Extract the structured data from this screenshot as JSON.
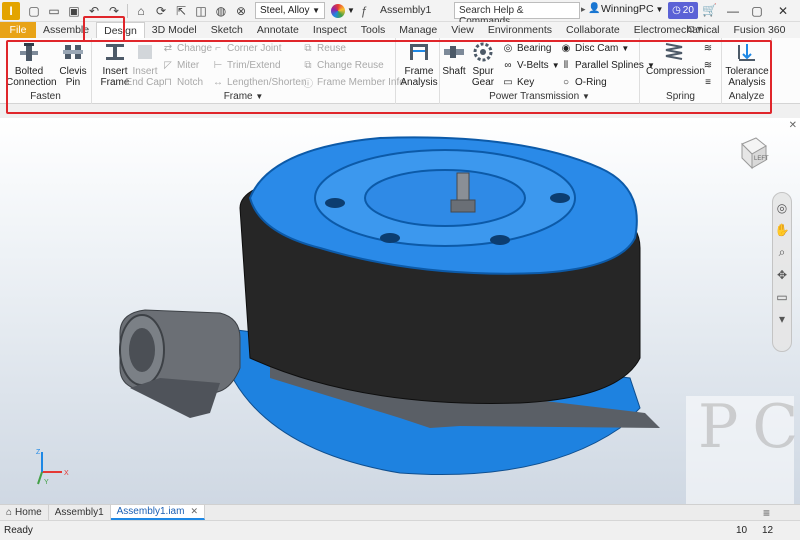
{
  "app": {
    "logo_letter": "I",
    "document_title": "Assembly1",
    "material": "Steel, Alloy",
    "search_placeholder": "Search Help & Commands...",
    "user_name": "WinningPC",
    "clock_badge": "20"
  },
  "tabs": [
    {
      "label": "File"
    },
    {
      "label": "Assemble"
    },
    {
      "label": "Design",
      "active": true
    },
    {
      "label": "3D Model"
    },
    {
      "label": "Sketch"
    },
    {
      "label": "Annotate"
    },
    {
      "label": "Inspect"
    },
    {
      "label": "Tools"
    },
    {
      "label": "Manage"
    },
    {
      "label": "View"
    },
    {
      "label": "Environments"
    },
    {
      "label": "Collaborate"
    },
    {
      "label": "Electromechanical"
    },
    {
      "label": "Fusion 360"
    }
  ],
  "ribbon": {
    "fasten": {
      "label": "Fasten",
      "bolted_connection": "Bolted\nConnection",
      "clevis_pin": "Clevis\nPin"
    },
    "frame": {
      "label": "Frame",
      "insert_frame": "Insert\nFrame",
      "insert_end_cap": "Insert\nEnd Cap",
      "change": "Change",
      "miter": "Miter",
      "notch": "Notch",
      "corner_joint": "Corner Joint",
      "trim_extend": "Trim/Extend",
      "lengthen_shorten": "Lengthen/Shorten",
      "reuse": "Reuse",
      "change_reuse": "Change Reuse",
      "frame_member_info": "Frame Member Info"
    },
    "frame_analysis": {
      "label": "Frame\nAnalysis"
    },
    "power_transmission": {
      "label": "Power Transmission",
      "shaft": "Shaft",
      "spur_gear": "Spur\nGear",
      "bearing": "Bearing",
      "v_belts": "V-Belts",
      "key": "Key",
      "disc_cam": "Disc Cam",
      "parallel_splines": "Parallel Splines",
      "o_ring": "O-Ring"
    },
    "spring": {
      "label": "Spring",
      "compression": "Compression"
    },
    "analyze": {
      "label": "Analyze",
      "tolerance_analysis": "Tolerance\nAnalysis"
    }
  },
  "viewcube_face": "LEFT",
  "triad": {
    "x": "X",
    "y": "Y",
    "z": "Z"
  },
  "watermark": "PC",
  "doc_tabs": [
    {
      "label": "Home"
    },
    {
      "label": "Assembly1"
    },
    {
      "label": "Assembly1.iam",
      "active": true
    }
  ],
  "status": {
    "left": "Ready",
    "num1": "10",
    "num2": "12"
  },
  "colors": {
    "file_tab": "#e8a317",
    "highlight": "#e0262b",
    "model_blue": "#1e82e0",
    "model_dark": "#222222"
  }
}
